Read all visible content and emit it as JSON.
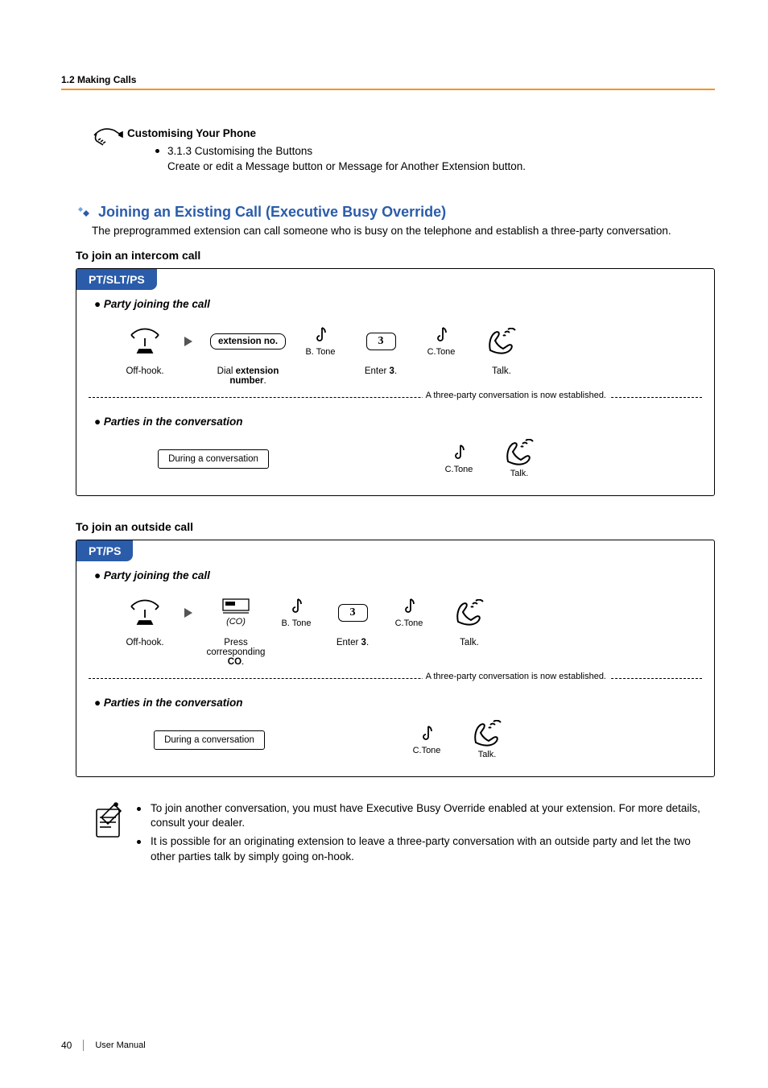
{
  "breadcrumb": "1.2 Making Calls",
  "customising": {
    "title": "Customising Your Phone",
    "item_title": "3.1.3 Customising the Buttons",
    "item_desc": "Create or edit a Message button or Message for Another Extension button."
  },
  "section": {
    "title": "Joining an Existing Call (Executive Busy Override)",
    "desc": "The preprogrammed extension can call someone who is busy on the telephone and establish a three-party conversation."
  },
  "intercom": {
    "heading": "To join an intercom call",
    "tab": "PT/SLT/PS",
    "group1": "Party joining the call",
    "group2": "Parties in the conversation",
    "ext_key": "extension no.",
    "btone": "B. Tone",
    "three_key": "3",
    "ctone": "C.Tone",
    "offhook": "Off-hook.",
    "dial_a": "Dial ",
    "dial_b": "extension number",
    "dial_c": ".",
    "enter_a": "Enter ",
    "enter_b": "3",
    "enter_c": ".",
    "talk": "Talk.",
    "note": "A three-party conversation is now established.",
    "during": "During a conversation"
  },
  "outside": {
    "heading": "To join an outside call",
    "tab": "PT/PS",
    "group1": "Party joining the call",
    "group2": "Parties in the conversation",
    "co": "(CO)",
    "btone": "B. Tone",
    "three_key": "3",
    "ctone": "C.Tone",
    "offhook": "Off-hook.",
    "press_a": "Press corresponding ",
    "press_b": "CO",
    "press_c": ".",
    "enter_a": "Enter ",
    "enter_b": "3",
    "enter_c": ".",
    "talk": "Talk.",
    "note": "A three-party conversation is now established.",
    "during": "During a conversation"
  },
  "notes": {
    "n1": "To join another conversation, you must have Executive Busy Override enabled at your extension. For more details, consult your dealer.",
    "n2": "It is possible for an originating extension to leave a three-party conversation with an outside party and let the two other parties talk by simply going on-hook."
  },
  "footer": {
    "page": "40",
    "label": "User Manual"
  }
}
